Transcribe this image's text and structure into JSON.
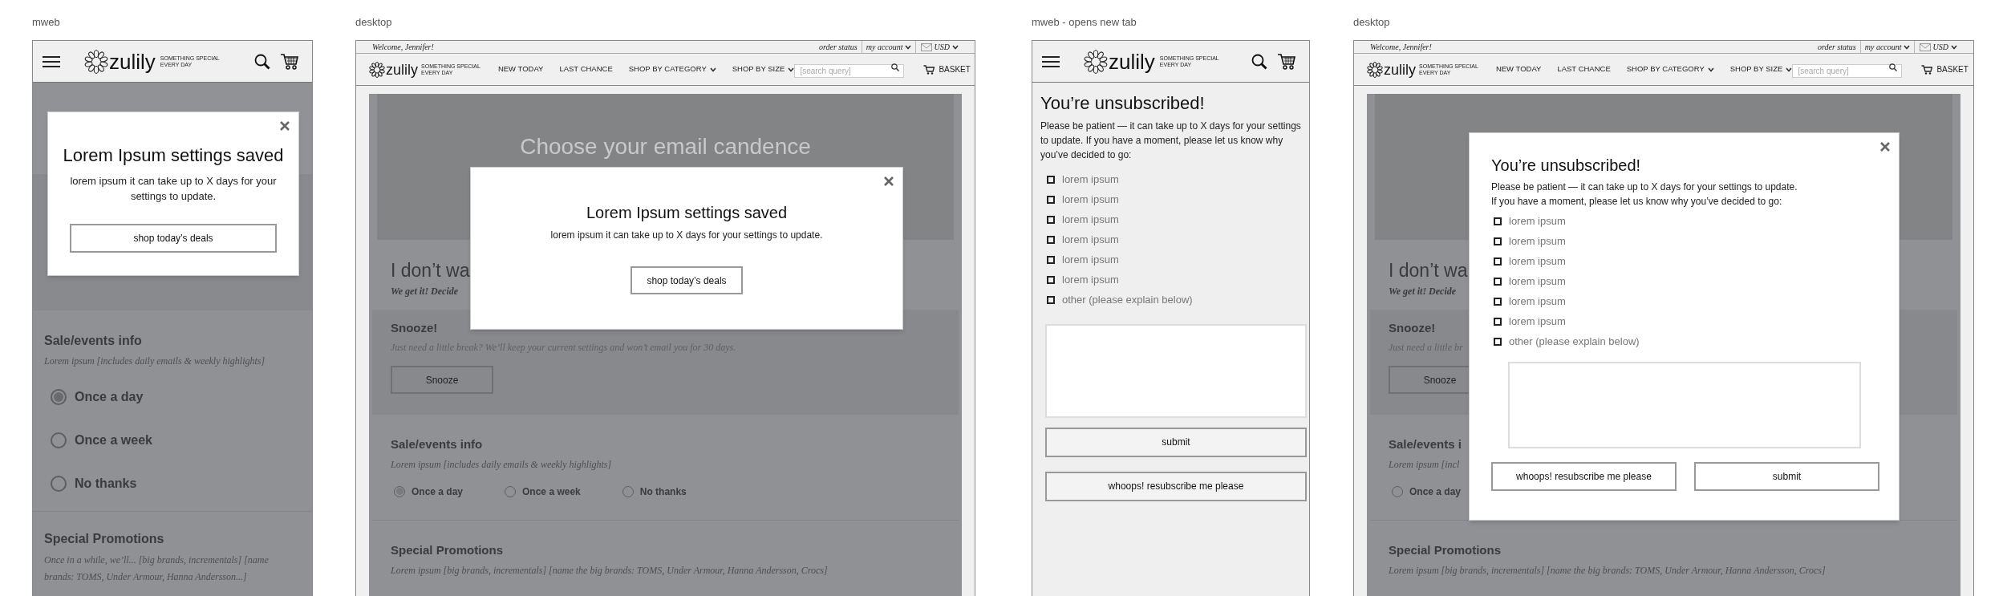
{
  "panels": [
    {
      "kind": "mweb",
      "caption": "mweb",
      "header": {
        "logo": "zulily",
        "tagline": [
          "SOMETHING SPECIAL",
          "EVERY DAY"
        ]
      },
      "sections": [
        {
          "kind": "radio",
          "title": "Sale/events info",
          "text": "Lorem ipsum [includes daily emails &  weekly highlights]",
          "options": [
            {
              "label": "Once a day",
              "selected": true
            },
            {
              "label": "Once a week",
              "selected": false
            },
            {
              "label": "No thanks",
              "selected": false
            }
          ]
        },
        {
          "kind": "promo",
          "title": "Special Promotions",
          "text": "Once in a while, we’ll... [big brands, incrementals] [name brands: TOMS, Under Armour, Hanna Andersson...]"
        }
      ],
      "modal": {
        "kind": "saved",
        "title": "Lorem Ipsum settings saved",
        "text": "lorem ipsum it can take up to X days for your settings to update.",
        "button": "shop today’s deals"
      }
    },
    {
      "kind": "desktop",
      "caption": "desktop",
      "header": {
        "welcome": "Welcome, Jennifer!",
        "account_links": [
          {
            "label": "order status",
            "dropdown": false
          },
          {
            "label": "my account",
            "dropdown": true
          }
        ],
        "currency": {
          "label": "USD",
          "dropdown": true
        },
        "logo": "zulily",
        "tagline": [
          "SOMETHING SPECIAL",
          "EVERY DAY"
        ],
        "nav": [
          {
            "label": "NEW TODAY",
            "dropdown": false
          },
          {
            "label": "LAST CHANCE",
            "dropdown": false
          },
          {
            "label": "SHOP BY CATEGORY",
            "dropdown": true
          },
          {
            "label": "SHOP BY SIZE",
            "dropdown": true
          }
        ],
        "search_placeholder": "[search query]",
        "basket": "BASKET"
      },
      "sections": [
        {
          "kind": "hero",
          "title": "Choose your email candence"
        },
        {
          "kind": "intro",
          "title": "I don’t wa",
          "text": "We get it! Decide"
        },
        {
          "kind": "snooze",
          "title": "Snooze!",
          "text": "Just need a little break? We’ll keep your current settings and won’t email you for 30 days.",
          "button": "Snooze"
        },
        {
          "kind": "radio",
          "title": "Sale/events info",
          "text": "Lorem ipsum [includes daily emails &  weekly highlights]",
          "options": [
            {
              "label": "Once a day",
              "selected": true
            },
            {
              "label": "Once a week",
              "selected": false
            },
            {
              "label": "No thanks",
              "selected": false
            }
          ]
        },
        {
          "kind": "promo",
          "title": "Special Promotions",
          "text": "Lorem ipsum [big brands, incrementals] [name the big brands: TOMS, Under Armour, Hanna Andersson, Crocs]"
        }
      ],
      "modal": {
        "kind": "saved",
        "title": "Lorem Ipsum settings saved",
        "text": "lorem ipsum it can take up to X days for your settings to update.",
        "button": "shop today’s deals"
      }
    },
    {
      "kind": "mweb",
      "caption": "mweb - opens new tab",
      "header": {
        "logo": "zulily",
        "tagline": [
          "SOMETHING SPECIAL",
          "EVERY DAY"
        ]
      },
      "form": {
        "title": "You’re unsubscribed!",
        "text": "Please be patient — it can take up to X days for your settings to update. If you have a moment, please let us know why you’ve decided to go:",
        "reasons": [
          {
            "label": "lorem ipsum",
            "checked": false
          },
          {
            "label": "lorem ipsum",
            "checked": false
          },
          {
            "label": "lorem ipsum",
            "checked": false
          },
          {
            "label": "lorem ipsum",
            "checked": false
          },
          {
            "label": "lorem ipsum",
            "checked": false
          },
          {
            "label": "lorem ipsum",
            "checked": false
          },
          {
            "label": "other (please explain below)",
            "checked": false
          }
        ],
        "buttons": [
          "submit",
          "whoops! resubscribe me please"
        ]
      }
    },
    {
      "kind": "desktop",
      "caption": "desktop",
      "header": {
        "welcome": "Welcome, Jennifer!",
        "account_links": [
          {
            "label": "order status",
            "dropdown": false
          },
          {
            "label": "my account",
            "dropdown": true
          }
        ],
        "currency": {
          "label": "USD",
          "dropdown": true
        },
        "logo": "zulily",
        "tagline": [
          "SOMETHING SPECIAL",
          "EVERY DAY"
        ],
        "nav": [
          {
            "label": "NEW TODAY",
            "dropdown": false
          },
          {
            "label": "LAST CHANCE",
            "dropdown": false
          },
          {
            "label": "SHOP BY CATEGORY",
            "dropdown": true
          },
          {
            "label": "SHOP BY SIZE",
            "dropdown": true
          }
        ],
        "search_placeholder": "[search query]",
        "basket": "BASKET"
      },
      "sections": [
        {
          "kind": "hero"
        },
        {
          "kind": "intro",
          "title": "I don’t wa",
          "text": "We get it! Decide"
        },
        {
          "kind": "snooze",
          "title": "Snooze!",
          "text": "Just need a little br",
          "button": "Snooze"
        },
        {
          "kind": "radio",
          "title": "Sale/events i",
          "text": "Lorem ipsum [incl",
          "options": [
            {
              "label": "Once a day",
              "selected": false
            }
          ]
        },
        {
          "kind": "promo",
          "title": "Special Promotions",
          "text": "Lorem ipsum [big brands, incrementals] [name the big brands: TOMS, Under Armour, Hanna Andersson, Crocs]"
        }
      ],
      "modal": {
        "kind": "unsubscribe",
        "title": "You’re unsubscribed!",
        "text": "Please be patient — it can take up to X days for your settings to update.\nIf you have a moment, please let us know why you’ve decided to go:",
        "reasons": [
          {
            "label": "lorem ipsum",
            "checked": false
          },
          {
            "label": "lorem ipsum",
            "checked": false
          },
          {
            "label": "lorem ipsum",
            "checked": false
          },
          {
            "label": "lorem ipsum",
            "checked": false
          },
          {
            "label": "lorem ipsum",
            "checked": false
          },
          {
            "label": "lorem ipsum",
            "checked": false
          },
          {
            "label": "other (please explain below)",
            "checked": false
          }
        ],
        "buttons": [
          "whoops! resubscribe me please",
          "submit"
        ]
      }
    }
  ]
}
